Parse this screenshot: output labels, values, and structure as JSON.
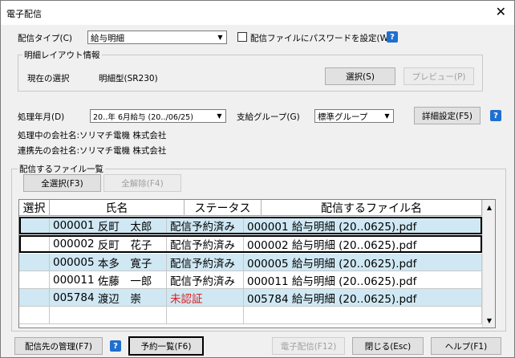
{
  "window": {
    "title": "電子配信",
    "close": "✕"
  },
  "top": {
    "type_label": "配信タイプ(C)",
    "type_value": "給与明細",
    "password_label": "配信ファイルにパスワードを設定(W)",
    "help": "?"
  },
  "layout": {
    "group_label": "明細レイアウト情報",
    "current_label": "現在の選択",
    "current_value": "明細型(SR230)",
    "select_button": "選択(S)",
    "preview_button": "プレビュー(P)"
  },
  "process": {
    "month_label": "処理年月(D)",
    "month_value": "20‥年 6月給与 (20‥/06/25)",
    "group_label": "支給グループ(G)",
    "group_value": "標準グループ",
    "detail_button": "詳細設定(F5)"
  },
  "company": {
    "processing": "処理中の会社名:ソリマチ電機  株式会社",
    "linked": "連携先の会社名:ソリマチ電機  株式会社"
  },
  "files": {
    "group_label": "配信するファイル一覧",
    "select_all": "全選択(F3)",
    "deselect_all": "全解除(F4)",
    "columns": [
      "選択",
      "氏名",
      "ステータス",
      "配信するファイル名"
    ],
    "rows": [
      {
        "id": "000001",
        "name": "反町　太郎",
        "status": "配信予約済み",
        "file": "000001 給与明細 (20‥0625).pdf",
        "status_color": "#000000"
      },
      {
        "id": "000002",
        "name": "反町　花子",
        "status": "配信予約済み",
        "file": "000002 給与明細 (20‥0625).pdf",
        "status_color": "#000000"
      },
      {
        "id": "000005",
        "name": "本多　寛子",
        "status": "配信予約済み",
        "file": "000005 給与明細 (20‥0625).pdf",
        "status_color": "#000000"
      },
      {
        "id": "000011",
        "name": "佐藤　一郎",
        "status": "配信予約済み",
        "file": "000011 給与明細 (20‥0625).pdf",
        "status_color": "#000000"
      },
      {
        "id": "005784",
        "name": "渡辺　崇",
        "status": "未認証",
        "file": "005784 給与明細 (20‥0625).pdf",
        "status_color": "#e02020"
      }
    ]
  },
  "bottom": {
    "manage": "配信先の管理(F7)",
    "reserve_list": "予約一覧(F6)",
    "send": "電子配信(F12)",
    "close": "閉じる(Esc)",
    "help": "ヘルプ(F1)"
  }
}
